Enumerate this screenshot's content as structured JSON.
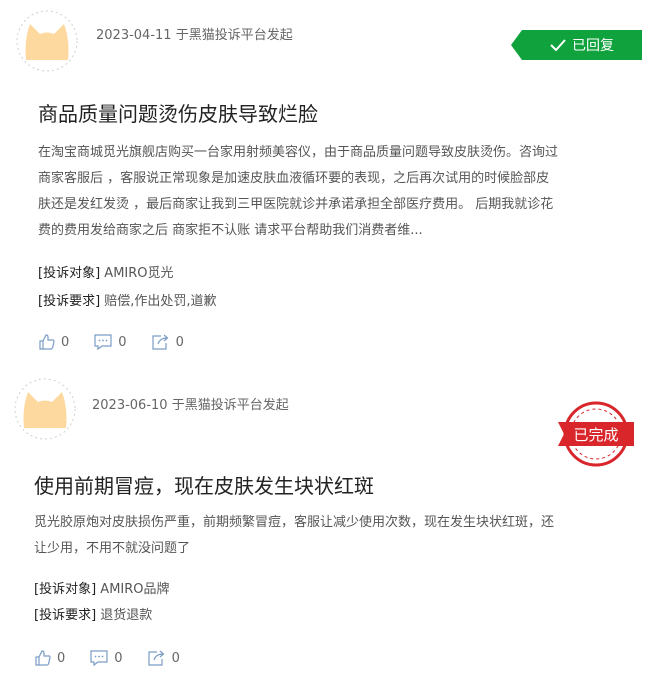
{
  "complaints": [
    {
      "date": "2023-04-11",
      "source": "于黑猫投诉平台发起",
      "status": "已回复",
      "title": "商品质量问题烫伤皮肤导致烂脸",
      "desc_lines": [
        "在淘宝商城觅光旗舰店购买一台家用射频美容仪，由于商品质量问题导致皮肤烫伤。咨询过",
        "商家客服后 ，客服说正常现象是加速皮肤血液循环要的表现，之后再次试用的时候脸部皮",
        "肤还是发红发烫 ，最后商家让我到三甲医院就诊并承诺承担全部医疗费用。 后期我就诊花",
        "费的费用发给商家之后 商家拒不认账 请求平台帮助我们消费者维..."
      ],
      "object_key": "[投诉对象]",
      "object": "AMIRO觅光",
      "request_key": "[投诉要求]",
      "request": "赔偿,作出处罚,道歉",
      "likes": "0",
      "comments": "0",
      "shares": "0"
    },
    {
      "date": "2023-06-10",
      "source": "于黑猫投诉平台发起",
      "status": "已完成",
      "title": "使用前期冒痘，现在皮肤发生块状红斑",
      "desc_lines": [
        "觅光胶原炮对皮肤损伤严重，前期频繁冒痘，客服让减少使用次数，现在发生块状红斑，还",
        "让少用，不用不就没问题了"
      ],
      "object_key": "[投诉对象]",
      "object": "AMIRO品牌",
      "request_key": "[投诉要求]",
      "request": "退货退款",
      "likes": "0",
      "comments": "0",
      "shares": "0"
    }
  ]
}
